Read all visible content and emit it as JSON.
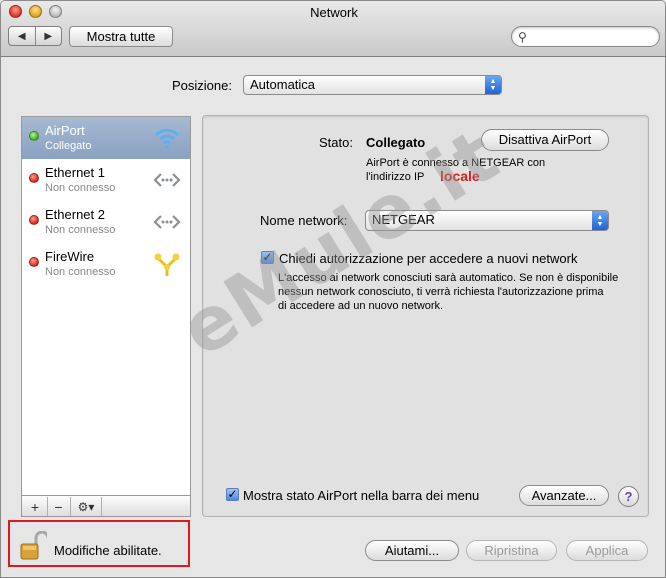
{
  "window": {
    "title": "Network"
  },
  "toolbar": {
    "show_all_label": "Mostra tutte",
    "search_placeholder": ""
  },
  "location": {
    "label": "Posizione:",
    "value": "Automatica"
  },
  "services": [
    {
      "name": "AirPort",
      "status": "Collegato",
      "state": "connected",
      "icon": "wifi-icon"
    },
    {
      "name": "Ethernet 1",
      "status": "Non connesso",
      "state": "disconnected",
      "icon": "ethernet-icon"
    },
    {
      "name": "Ethernet 2",
      "status": "Non connesso",
      "state": "disconnected",
      "icon": "ethernet-icon"
    },
    {
      "name": "FireWire",
      "status": "Non connesso",
      "state": "disconnected",
      "icon": "firewire-icon"
    }
  ],
  "sidebar_footer": {
    "add": "+",
    "remove": "−",
    "action": "⚙▾"
  },
  "detail": {
    "status_label": "Stato:",
    "status_value": "Collegato",
    "disable_button": "Disattiva AirPort",
    "description_line1": "AirPort è connesso a NETGEAR con",
    "description_line2": "l'indirizzo IP",
    "ip_note": "locale",
    "network_name_label": "Nome network:",
    "network_name_value": "NETGEAR",
    "ask_checkbox_label": "Chiedi autorizzazione per accedere a nuovi network",
    "ask_description": [
      "L'accesso ai network conosciuti sarà automatico. Se non è disponibile",
      "nessun network conosciuto, ti verrà richiesta l'autorizzazione prima",
      "di accedere ad un nuovo network."
    ],
    "menubar_checkbox_label": "Mostra stato AirPort nella barra dei menu",
    "advanced_button": "Avanzate...",
    "help_button": "?"
  },
  "footer": {
    "lock_label": "Modifiche abilitate.",
    "help_button": "Aiutami...",
    "revert_button": "Ripristina",
    "apply_button": "Applica"
  },
  "watermark": "eMule.it",
  "colors": {
    "highlight_red": "#e0191f",
    "selection": "#8aa1c1",
    "accent_blue": "#1f63d5"
  }
}
